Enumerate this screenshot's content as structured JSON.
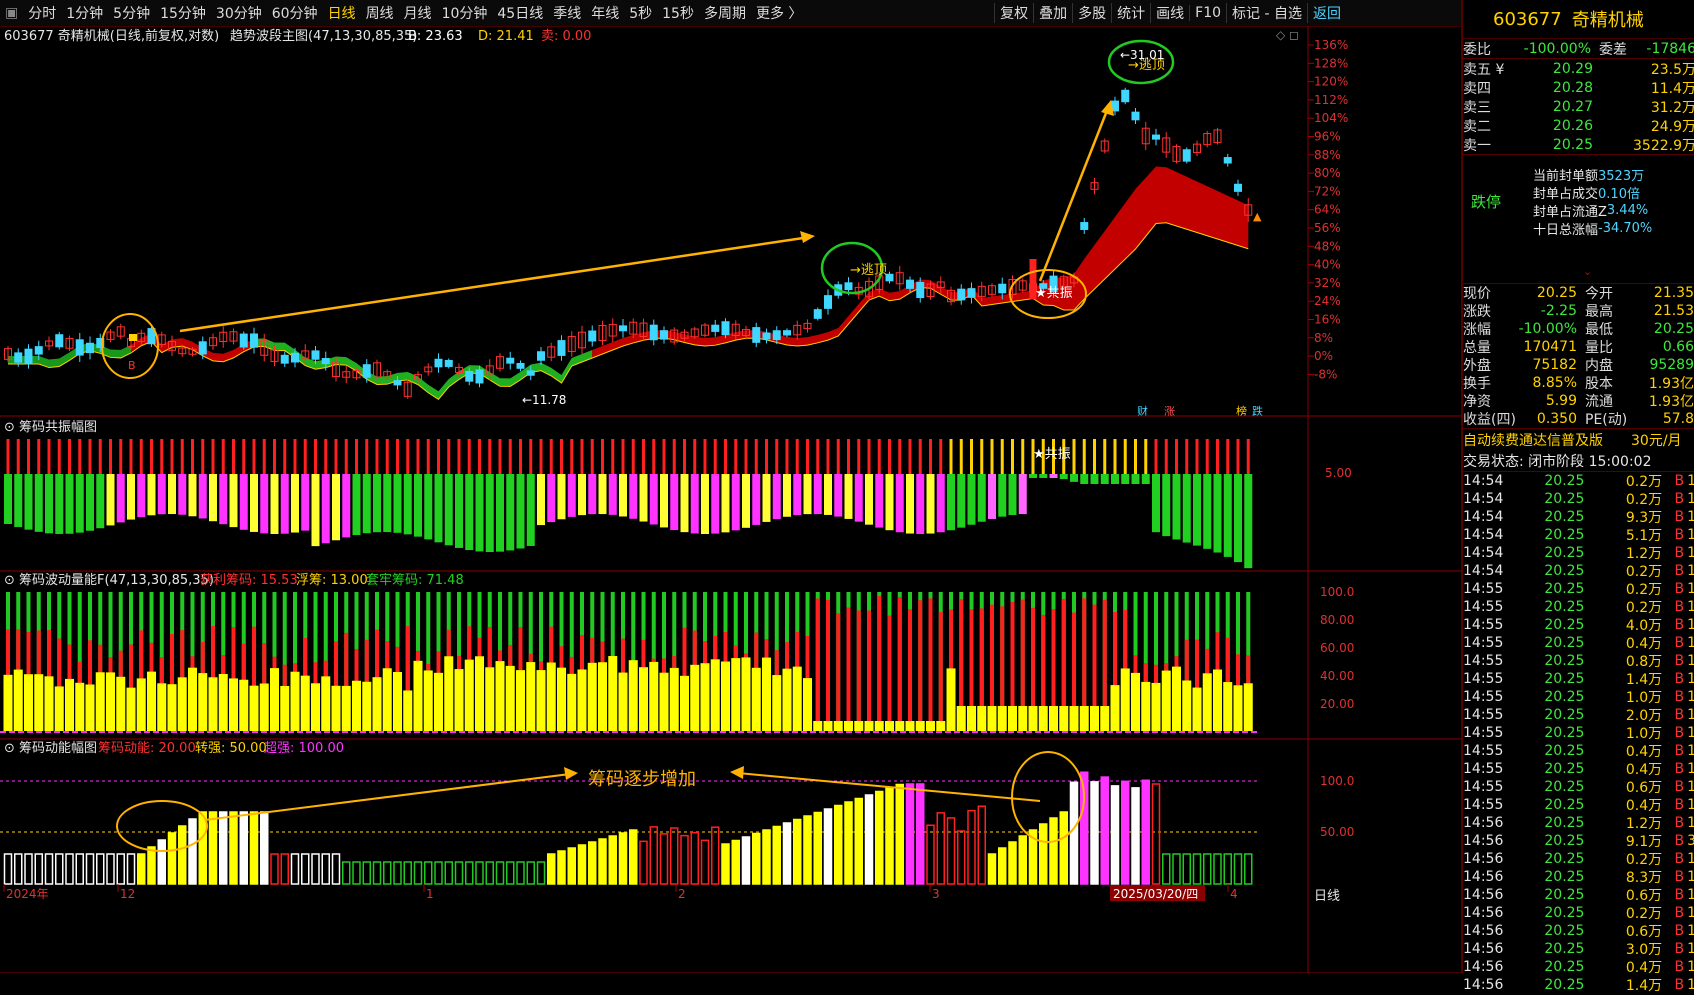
{
  "toolbar": {
    "periods": [
      "分时",
      "1分钟",
      "5分钟",
      "15分钟",
      "30分钟",
      "60分钟",
      "日线",
      "周线",
      "月线",
      "10分钟",
      "45日线",
      "季线",
      "年线",
      "5秒",
      "15秒",
      "多周期",
      "更多 〉"
    ],
    "active_period": "日线",
    "right_buttons": [
      "复权",
      "叠加",
      "多股",
      "统计",
      "画线",
      "F10",
      "标记 - 自选",
      "返回"
    ]
  },
  "main_chart": {
    "title": "603677 奇精机械(日线,前复权,对数)",
    "indicator": "趋势波段主图(47,13,30,85,35)",
    "b_label": "B: 23.63",
    "d_label": "D: 21.41",
    "s_label": "卖: 0.00",
    "high_label": "31.01",
    "low_label": "11.78",
    "escape_top_label": "逃顶",
    "resonance_label": "★共振",
    "buy_marker": "B",
    "percent_axis": [
      "136%",
      "128%",
      "120%",
      "112%",
      "104%",
      "96%",
      "88%",
      "80%",
      "72%",
      "64%",
      "56%",
      "48%",
      "40%",
      "32%",
      "24%",
      "16%",
      "8%",
      "0%",
      "-8%"
    ],
    "badges": [
      "财",
      "涨",
      "榜",
      "跌"
    ]
  },
  "panel2": {
    "title": "筹码共振幅图",
    "axis_label": "5.00",
    "resonance_label": "★共振"
  },
  "panel3": {
    "title": "筹码波动量能F(47,13,30,85,35)",
    "profit_label": "获利筹码: 15.53",
    "float_label": "浮筹: 13.00",
    "trapped_label": "套牢筹码: 71.48",
    "axis": [
      "100.0",
      "80.00",
      "60.00",
      "40.00",
      "20.00"
    ]
  },
  "panel4": {
    "title": "筹码动能幅图",
    "power_label": "筹码动能: 20.00",
    "turn_label": "转强: 50.00",
    "super_label": "超强: 100.00",
    "annotation": "筹码逐步增加",
    "axis": [
      "100.0",
      "50.00"
    ]
  },
  "date_axis": {
    "labels": [
      "2024年",
      "12",
      "1",
      "2",
      "3",
      "4"
    ],
    "cursor_date": "2025/03/20/四",
    "period_label": "日线"
  },
  "quote": {
    "code": "603677",
    "name": "奇精机械",
    "webi_label": "委比",
    "webi": "-100.00%",
    "weicha_label": "委差",
    "weicha": "-17846",
    "asks": [
      {
        "label": "卖五 ¥",
        "price": "20.29",
        "vol": "23.5万"
      },
      {
        "label": "卖四",
        "price": "20.28",
        "vol": "11.4万"
      },
      {
        "label": "卖三",
        "price": "20.27",
        "vol": "31.2万"
      },
      {
        "label": "卖二",
        "price": "20.26",
        "vol": "24.9万"
      },
      {
        "label": "卖一",
        "price": "20.25",
        "vol": "3522.9万"
      }
    ],
    "limit_status": "跌停",
    "limit_info": [
      {
        "label": "当前封单额",
        "value": "3523万"
      },
      {
        "label": "封单占成交",
        "value": "0.10倍"
      },
      {
        "label": "封单占流通Z",
        "value": "3.44%"
      },
      {
        "label": "十日总涨幅",
        "value": "-34.70%"
      }
    ],
    "stats": [
      [
        "现价",
        "20.25",
        "今开",
        "21.35"
      ],
      [
        "涨跌",
        "-2.25",
        "最高",
        "21.53"
      ],
      [
        "涨幅",
        "-10.00%",
        "最低",
        "20.25"
      ],
      [
        "总量",
        "170471",
        "量比",
        "0.66"
      ],
      [
        "外盘",
        "75182",
        "内盘",
        "95289"
      ],
      [
        "换手",
        "8.85%",
        "股本",
        "1.93亿"
      ],
      [
        "净资",
        "5.99",
        "流通",
        "1.93亿"
      ],
      [
        "收益(四)",
        "0.350",
        "PE(动)",
        "57.8"
      ]
    ],
    "ad_text": "自动续费通达信普及版",
    "ad_price": "30元/月",
    "trade_status": "交易状态: 闭市阶段 15:00:02"
  },
  "ticks": [
    [
      "14:54",
      "20.25",
      "0.2万",
      "B",
      "1"
    ],
    [
      "14:54",
      "20.25",
      "0.2万",
      "B",
      "1"
    ],
    [
      "14:54",
      "20.25",
      "9.3万",
      "B",
      "1"
    ],
    [
      "14:54",
      "20.25",
      "5.1万",
      "B",
      "1"
    ],
    [
      "14:54",
      "20.25",
      "1.2万",
      "B",
      "1"
    ],
    [
      "14:54",
      "20.25",
      "0.2万",
      "B",
      "1"
    ],
    [
      "14:55",
      "20.25",
      "0.2万",
      "B",
      "1"
    ],
    [
      "14:55",
      "20.25",
      "0.2万",
      "B",
      "1"
    ],
    [
      "14:55",
      "20.25",
      "4.0万",
      "B",
      "1"
    ],
    [
      "14:55",
      "20.25",
      "0.4万",
      "B",
      "1"
    ],
    [
      "14:55",
      "20.25",
      "0.8万",
      "B",
      "1"
    ],
    [
      "14:55",
      "20.25",
      "1.4万",
      "B",
      "1"
    ],
    [
      "14:55",
      "20.25",
      "1.0万",
      "B",
      "1"
    ],
    [
      "14:55",
      "20.25",
      "2.0万",
      "B",
      "1"
    ],
    [
      "14:55",
      "20.25",
      "1.0万",
      "B",
      "1"
    ],
    [
      "14:55",
      "20.25",
      "0.4万",
      "B",
      "1"
    ],
    [
      "14:55",
      "20.25",
      "0.4万",
      "B",
      "1"
    ],
    [
      "14:55",
      "20.25",
      "0.6万",
      "B",
      "1"
    ],
    [
      "14:55",
      "20.25",
      "0.4万",
      "B",
      "1"
    ],
    [
      "14:56",
      "20.25",
      "1.2万",
      "B",
      "1"
    ],
    [
      "14:56",
      "20.25",
      "9.1万",
      "B",
      "3"
    ],
    [
      "14:56",
      "20.25",
      "0.2万",
      "B",
      "1"
    ],
    [
      "14:56",
      "20.25",
      "8.3万",
      "B",
      "1"
    ],
    [
      "14:56",
      "20.25",
      "0.6万",
      "B",
      "1"
    ],
    [
      "14:56",
      "20.25",
      "0.2万",
      "B",
      "1"
    ],
    [
      "14:56",
      "20.25",
      "0.6万",
      "B",
      "1"
    ],
    [
      "14:56",
      "20.25",
      "3.0万",
      "B",
      "1"
    ],
    [
      "14:56",
      "20.25",
      "0.4万",
      "B",
      "1"
    ],
    [
      "14:56",
      "20.25",
      "1.4万",
      "B",
      "1"
    ]
  ]
}
